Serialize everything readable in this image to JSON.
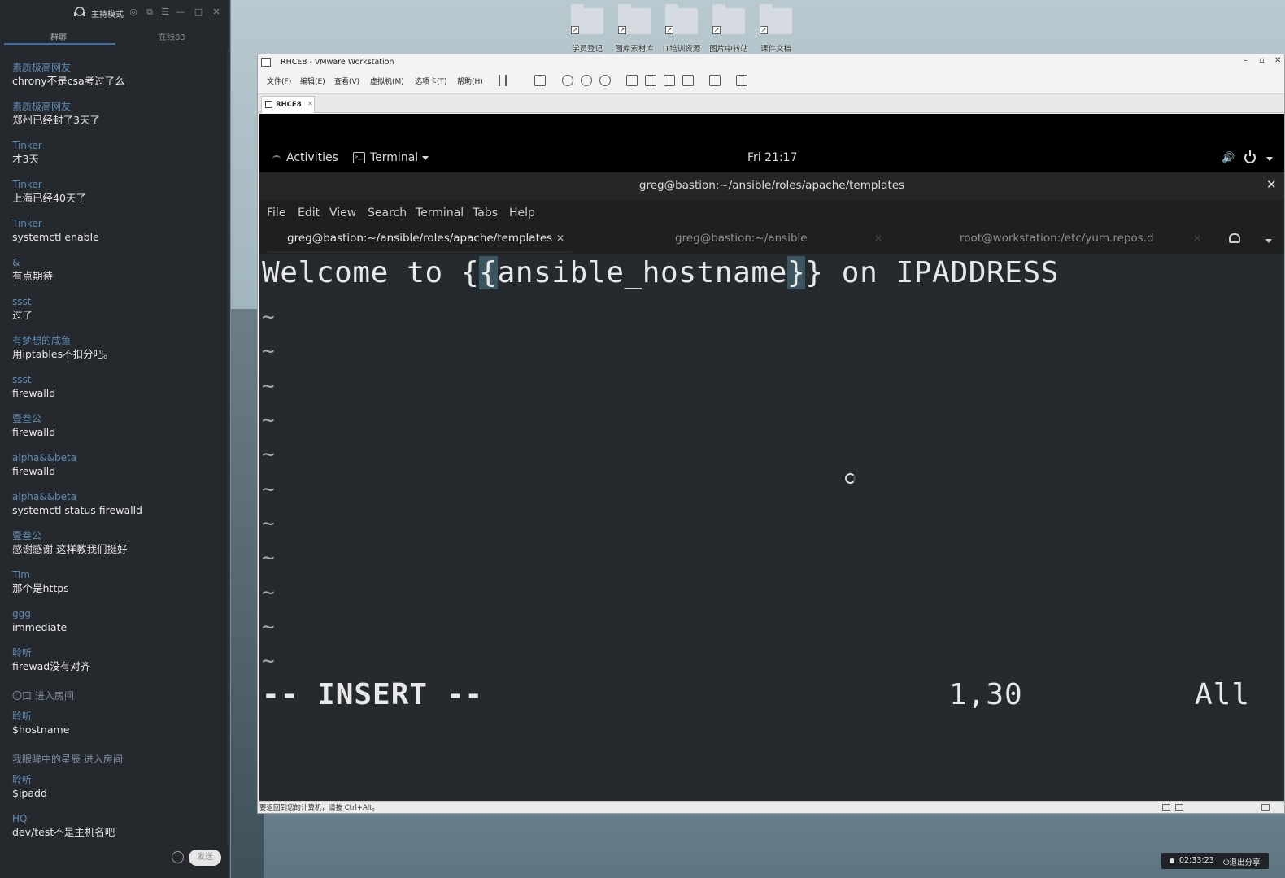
{
  "chat": {
    "title": "主持模式",
    "tabs": [
      "群聊",
      "在线83"
    ],
    "messages": [
      {
        "user": "素质极高网友",
        "text": "chrony不是csa考过了么"
      },
      {
        "user": "素质极高网友",
        "text": "郑州已经封了3天了"
      },
      {
        "user": "Tinker",
        "text": "才3天"
      },
      {
        "user": "Tinker",
        "text": "上海已经40天了"
      },
      {
        "user": "Tinker",
        "text": "systemctl enable"
      },
      {
        "user": "&",
        "text": "有点期待"
      },
      {
        "user": "ssst",
        "text": "过了"
      },
      {
        "user": "有梦想的咸鱼",
        "text": "用iptables不扣分吧。"
      },
      {
        "user": "ssst",
        "text": "firewalld"
      },
      {
        "user": "壹叁公",
        "text": "firewalld"
      },
      {
        "user": "alpha&&beta",
        "text": "firewalld"
      },
      {
        "user": "alpha&&beta",
        "text": "systemctl status firewalld"
      },
      {
        "user": "壹叁公",
        "text": "感谢感谢  这样教我们挺好"
      },
      {
        "user": "Tim",
        "text": "那个是https"
      },
      {
        "user": "ggg",
        "text": "immediate"
      },
      {
        "user": "聆听",
        "text": "firewad没有对齐"
      }
    ],
    "system_1": "〇口 进入房间",
    "messages_2": [
      {
        "user": "聆听",
        "text": "$hostname"
      }
    ],
    "system_2": "我眼眸中的星辰 进入房间",
    "messages_3": [
      {
        "user": "聆听",
        "text": "$ipadd"
      },
      {
        "user": "HQ",
        "text": "dev/test不是主机名吧"
      }
    ],
    "send_label": "发送"
  },
  "desktop": {
    "icons": [
      "学员登记",
      "图库素材库",
      "IT培训资源",
      "图片中转站",
      "课件文档"
    ]
  },
  "vmware": {
    "title": "RHCE8 - VMware Workstation",
    "menus": [
      "文件(F)",
      "编辑(E)",
      "查看(V)",
      "虚拟机(M)",
      "选项卡(T)",
      "帮助(H)"
    ],
    "tab_label": "RHCE8",
    "status_text": "要返回到您的计算机，请按 Ctrl+Alt。"
  },
  "gnome": {
    "activities": "Activities",
    "app_menu": "Terminal",
    "clock": "Fri 21:17"
  },
  "terminal": {
    "title": "greg@bastion:~/ansible/roles/apache/templates",
    "menus": [
      "File",
      "Edit",
      "View",
      "Search",
      "Terminal",
      "Tabs",
      "Help"
    ],
    "tabs": [
      "greg@bastion:~/ansible/roles/apache/templates",
      "greg@bastion:~/ansible",
      "root@workstation:/etc/yum.repos.d"
    ]
  },
  "vim": {
    "line_pre": "Welcome to {",
    "brace_open": "{",
    "var_name": "ansible_hostname",
    "brace_close": "}",
    "line_post": "} on IPADDRESS",
    "tilde": "~",
    "mode": "-- INSERT --",
    "position": "1,30",
    "scroll": "All"
  },
  "share": {
    "timer": "02:33:23",
    "exit_label": "退出分享"
  }
}
